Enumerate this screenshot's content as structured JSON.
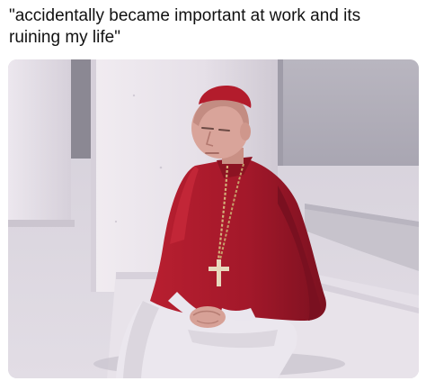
{
  "caption": {
    "text": "\"accidentally became important at work and its ruining my life\""
  },
  "photo": {
    "subject": "cardinal-in-red-cassock",
    "palette": {
      "robe": "#a3182a",
      "robe_shadow": "#6f0f1d",
      "zucchetto": "#b31c2c",
      "skin": "#d9a49a",
      "sleeve_white": "#eae6ee",
      "column": "#e9e3ea",
      "floor": "#d8d2dd",
      "wall": "#b5b2bd",
      "gravel": "#c9c6cf"
    }
  }
}
